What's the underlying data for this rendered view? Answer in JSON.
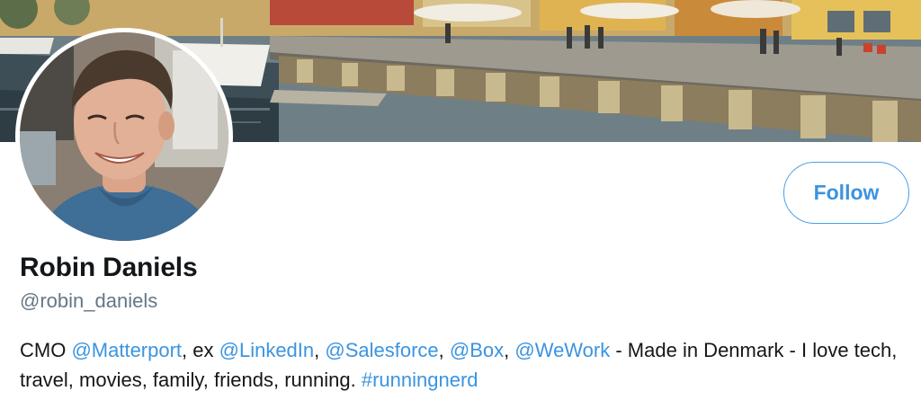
{
  "profile": {
    "display_name": "Robin Daniels",
    "handle": "@robin_daniels",
    "follow_label": "Follow"
  },
  "bio": {
    "prefix": "CMO ",
    "mention_1": "@Matterport",
    "sep_1": ", ex ",
    "mention_2": "@LinkedIn",
    "sep_2": ", ",
    "mention_3": "@Salesforce",
    "sep_3": ", ",
    "mention_4": "@Box",
    "sep_4": ", ",
    "mention_5": "@WeWork",
    "text_tail": " - Made in Denmark - I love tech, travel, movies, family, friends, running. ",
    "hashtag": "#runningnerd"
  },
  "colors": {
    "link": "#3b94e0",
    "name": "#14171a",
    "handle": "#657786",
    "follow_border": "#4a9ee8"
  },
  "images": {
    "banner": "harbour-banner-photo",
    "avatar": "profile-photo"
  }
}
